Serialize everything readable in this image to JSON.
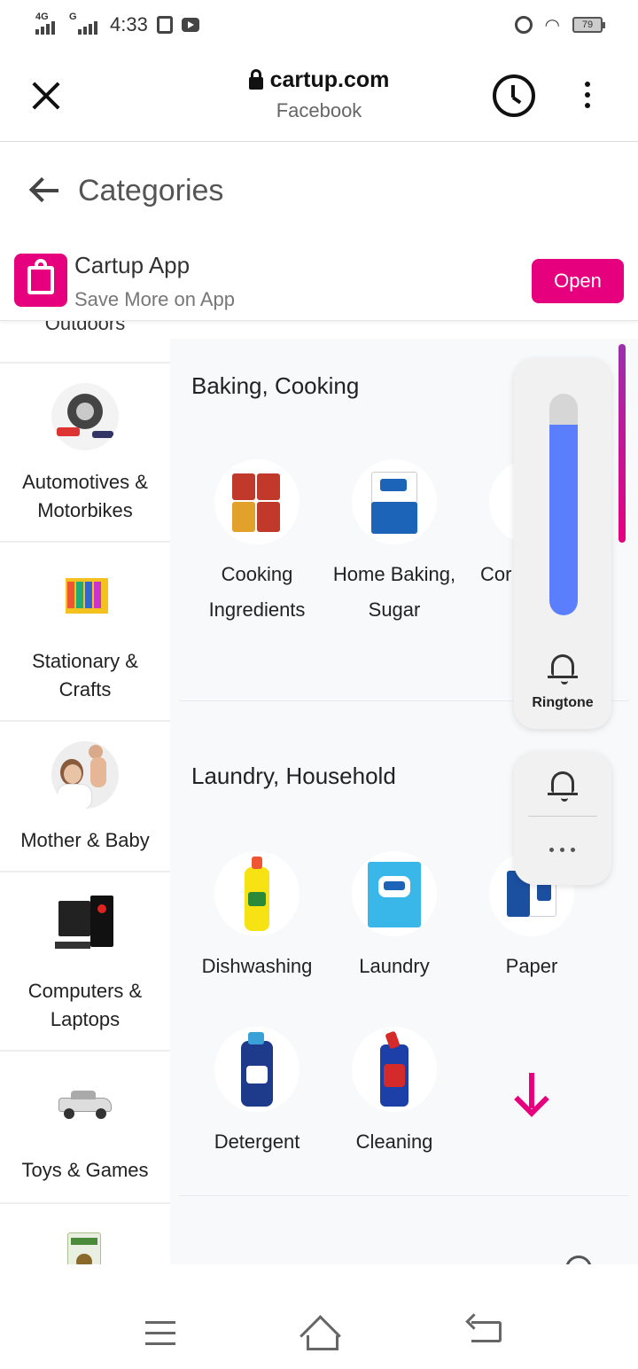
{
  "status_bar": {
    "network1": "4G",
    "network2": "G",
    "time": "4:33",
    "battery": "79"
  },
  "browser": {
    "url": "cartup.com",
    "subtitle": "Facebook"
  },
  "page": {
    "title": "Categories"
  },
  "app_banner": {
    "name": "Cartup App",
    "tagline": "Save More on App",
    "open_label": "Open",
    "accent": "#e6007e"
  },
  "categories": {
    "partial_top": "Outdoors",
    "items": [
      {
        "label": "Automotives & Motorbikes",
        "icon": "car-wheel-icon"
      },
      {
        "label": "Stationary & Crafts",
        "icon": "crayons-icon"
      },
      {
        "label": "Mother & Baby",
        "icon": "mother-baby-icon"
      },
      {
        "label": "Computers & Laptops",
        "icon": "computer-icon"
      },
      {
        "label": "Toys & Games",
        "icon": "toy-car-icon"
      }
    ]
  },
  "sections": [
    {
      "title": "Baking, Cooking",
      "products": [
        {
          "label": "Cooking Ingredients",
          "icon": "spice-packets-icon"
        },
        {
          "label": "Home Baking, Sugar",
          "icon": "sugar-pack-icon"
        },
        {
          "label": "Cor Dr",
          "icon": "partial-product-icon"
        }
      ]
    },
    {
      "title": "Laundry, Household",
      "products": [
        {
          "label": "Dishwashing",
          "icon": "dish-liquid-icon"
        },
        {
          "label": "Laundry",
          "icon": "detergent-pack-icon"
        },
        {
          "label": "Paper",
          "icon": "paper-ream-icon"
        },
        {
          "label": "Detergent",
          "icon": "detergent-bottle-icon"
        },
        {
          "label": "Cleaning",
          "icon": "toilet-cleaner-icon"
        }
      ]
    }
  ],
  "volume": {
    "label": "Ringtone",
    "level": 0.86,
    "fill_color": "#5b7ffc"
  }
}
